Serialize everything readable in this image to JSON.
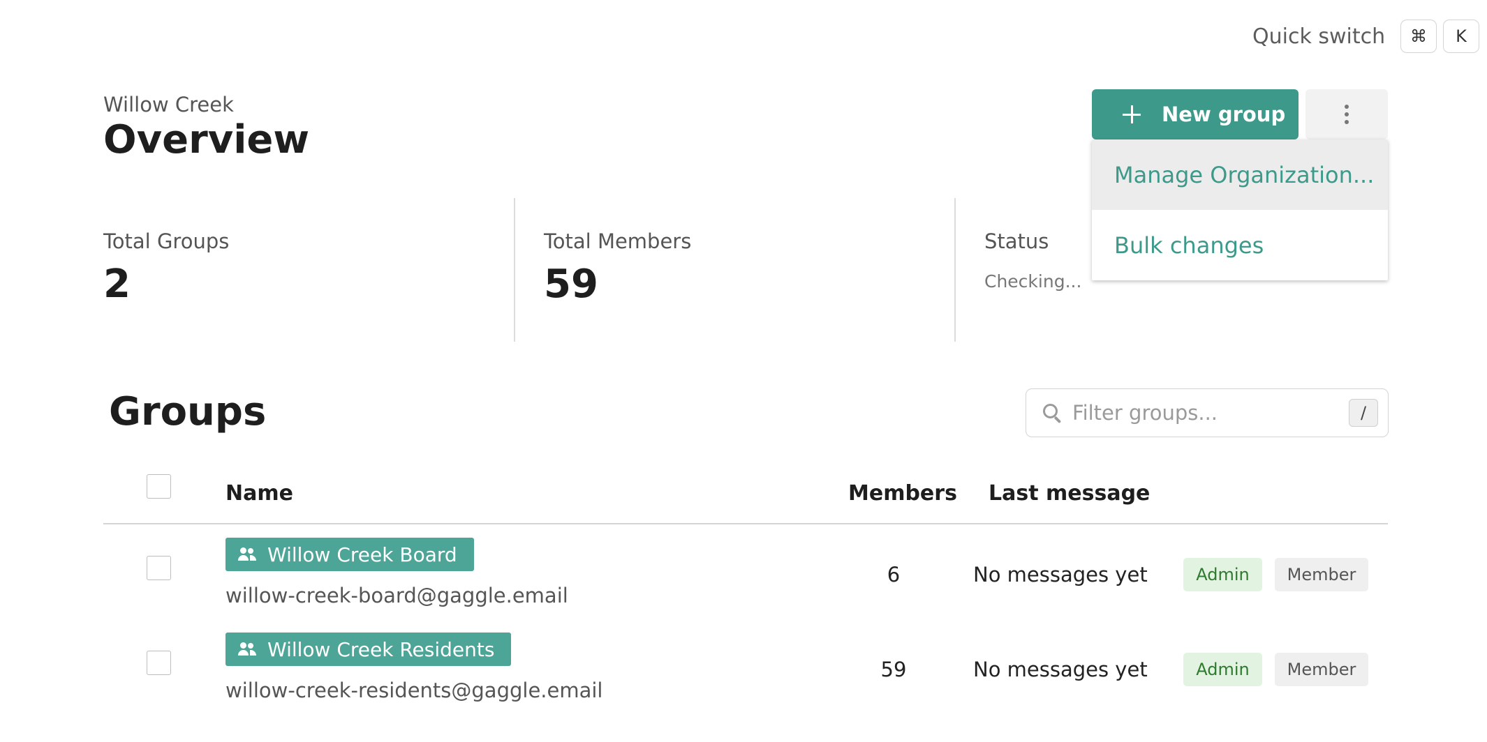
{
  "quick_switch": {
    "label": "Quick switch",
    "keys": [
      "⌘",
      "K"
    ]
  },
  "header": {
    "org_name": "Willow Creek",
    "title": "Overview",
    "new_group_label": "New group"
  },
  "dropdown": {
    "items": [
      {
        "label": "Manage Organization..."
      },
      {
        "label": "Bulk changes"
      }
    ]
  },
  "stats": {
    "total_groups_label": "Total Groups",
    "total_groups_value": "2",
    "total_members_label": "Total Members",
    "total_members_value": "59",
    "status_label": "Status",
    "status_value": "Checking..."
  },
  "groups": {
    "title": "Groups",
    "filter_placeholder": "Filter groups...",
    "filter_shortcut": "/",
    "columns": {
      "name": "Name",
      "members": "Members",
      "last_message": "Last message"
    },
    "rows": [
      {
        "name": "Willow Creek Board",
        "email": "willow-creek-board@gaggle.email",
        "members": "6",
        "last_message": "No messages yet",
        "badges": [
          "Admin",
          "Member"
        ]
      },
      {
        "name": "Willow Creek Residents",
        "email": "willow-creek-residents@gaggle.email",
        "members": "59",
        "last_message": "No messages yet",
        "badges": [
          "Admin",
          "Member"
        ]
      }
    ]
  },
  "colors": {
    "accent": "#3d9a8b",
    "chip": "#4da597",
    "admin_badge_bg": "#e3f3e1",
    "admin_badge_text": "#2e7a2e",
    "member_badge_bg": "#efefef"
  }
}
